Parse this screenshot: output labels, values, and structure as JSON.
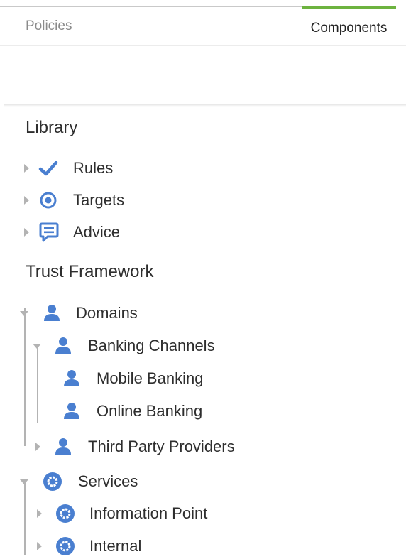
{
  "tabs": {
    "policies": "Policies",
    "components": "Components",
    "active": "Components"
  },
  "colors": {
    "accent": "#6db33f",
    "icon_blue": "#4a7fd0"
  },
  "library": {
    "title": "Library",
    "items": [
      {
        "label": "Rules",
        "icon": "check-icon"
      },
      {
        "label": "Targets",
        "icon": "target-icon"
      },
      {
        "label": "Advice",
        "icon": "chat-bubble-icon"
      }
    ]
  },
  "trust": {
    "title": "Trust Framework",
    "domains": {
      "label": "Domains",
      "icon": "user-icon",
      "banking_channels": {
        "label": "Banking Channels",
        "children": [
          "Mobile Banking",
          "Online Banking"
        ]
      },
      "third_party": "Third Party Providers"
    },
    "services": {
      "label": "Services",
      "icon": "gear-icon",
      "children": [
        "Information Point",
        "Internal"
      ]
    }
  }
}
